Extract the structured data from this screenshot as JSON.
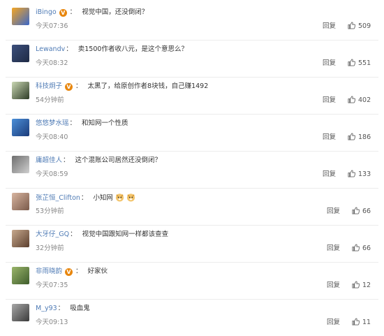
{
  "comments": [
    {
      "user": "iBingo",
      "verified": true,
      "verified_icon": "v-badge-icon",
      "text": "视觉中国，还没倒闭？",
      "time": "今天07:36",
      "reply": "回复",
      "likes": "509",
      "avatar_colors": [
        "#f5a623",
        "#3a67c9"
      ]
    },
    {
      "user": "Lewandv",
      "verified": false,
      "text": "卖1500作者收八元，是这个意思么？",
      "time": "今天08:32",
      "reply": "回复",
      "likes": "551",
      "avatar_colors": [
        "#3c4f7c",
        "#1e2a44"
      ]
    },
    {
      "user": "科技炯子",
      "verified": true,
      "verified_icon": "v-badge-icon",
      "text": "太黑了，给原创作者8块钱，自己赚1492",
      "time": "54分钟前",
      "reply": "回复",
      "likes": "402",
      "avatar_colors": [
        "#c9d7b3",
        "#2d3b26"
      ]
    },
    {
      "user": "悠悠梦水瑶",
      "verified": false,
      "text": "和知网一个性质",
      "time": "今天08:40",
      "reply": "回复",
      "likes": "186",
      "avatar_colors": [
        "#4b8fd8",
        "#1b3b7a"
      ]
    },
    {
      "user": "庸超佳人",
      "verified": false,
      "text": "这个混账公司居然还没倒闭？",
      "time": "今天08:59",
      "reply": "回复",
      "likes": "133",
      "avatar_colors": [
        "#6e6e6e",
        "#cfcfcf"
      ]
    },
    {
      "user": "张芷恒_Clifton",
      "verified": false,
      "text": "小知网",
      "emojis": [
        "doge-emoji-icon",
        "doge-emoji-icon"
      ],
      "time": "53分钟前",
      "reply": "回复",
      "likes": "66",
      "avatar_colors": [
        "#d8b5a0",
        "#7a5a4a"
      ]
    },
    {
      "user": "大牙仔_GQ",
      "verified": false,
      "text": "视觉中国跟知网一样都该查查",
      "time": "32分钟前",
      "reply": "回复",
      "likes": "66",
      "avatar_colors": [
        "#c7a98d",
        "#5c3f2e"
      ]
    },
    {
      "user": "非雨晓韵",
      "verified": true,
      "verified_icon": "v-badge-icon",
      "text": "好家伙",
      "time": "今天07:35",
      "reply": "回复",
      "likes": "12",
      "avatar_colors": [
        "#9ab56a",
        "#3f5d2c"
      ]
    },
    {
      "user": "M_y93",
      "verified": false,
      "text": "吸血鬼",
      "time": "今天09:13",
      "reply": "回复",
      "likes": "11",
      "avatar_colors": [
        "#a8a8a8",
        "#3a3a3a"
      ]
    }
  ],
  "colors": {
    "username": "#4f7bb5",
    "verified_badge": "#e8870f",
    "time": "#888888",
    "text": "#333333"
  },
  "like_icon": "thumbs-up-icon"
}
